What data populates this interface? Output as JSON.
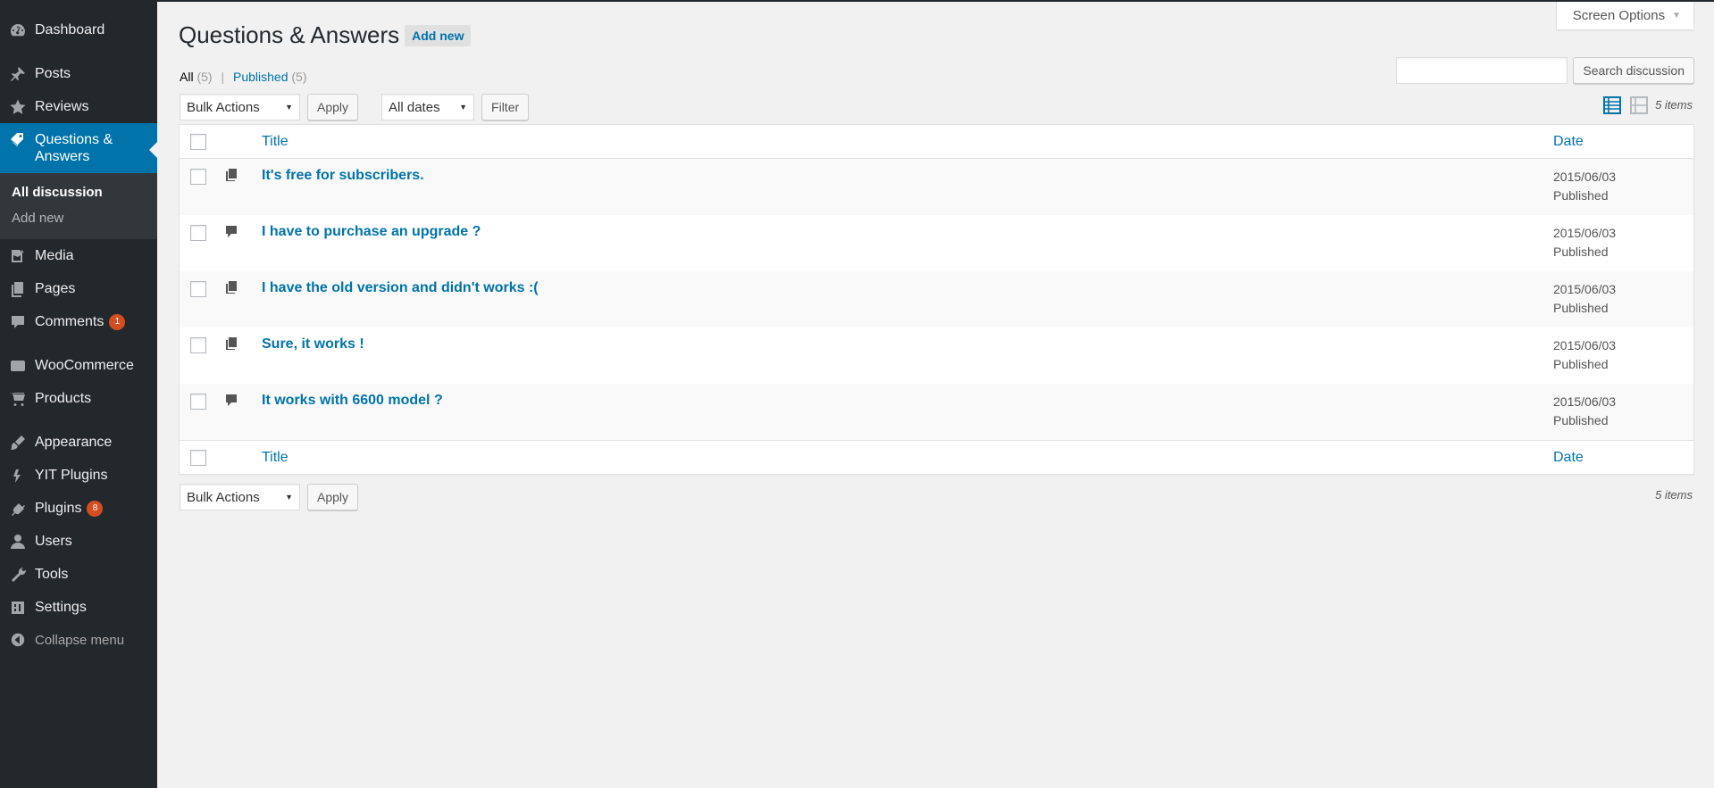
{
  "sidebar": {
    "items": [
      {
        "label": "Dashboard",
        "icon": "dashboard-icon"
      },
      {
        "label": "Posts",
        "icon": "pin-icon"
      },
      {
        "label": "Reviews",
        "icon": "star-icon"
      },
      {
        "label": "Questions & Answers",
        "icon": "tag-icon"
      },
      {
        "label": "Media",
        "icon": "media-icon"
      },
      {
        "label": "Pages",
        "icon": "pages-icon"
      },
      {
        "label": "Comments",
        "icon": "comment-icon",
        "badge": "1"
      },
      {
        "label": "WooCommerce",
        "icon": "woo-icon"
      },
      {
        "label": "Products",
        "icon": "cart-icon"
      },
      {
        "label": "Appearance",
        "icon": "brush-icon"
      },
      {
        "label": "YIT Plugins",
        "icon": "yit-icon"
      },
      {
        "label": "Plugins",
        "icon": "plug-icon",
        "badge": "8"
      },
      {
        "label": "Users",
        "icon": "user-icon"
      },
      {
        "label": "Tools",
        "icon": "wrench-icon"
      },
      {
        "label": "Settings",
        "icon": "settings-icon"
      }
    ],
    "submenu": [
      "All discussion",
      "Add new"
    ],
    "collapse": "Collapse menu"
  },
  "header": {
    "screen_options": "Screen Options",
    "title": "Questions & Answers",
    "add_new": "Add new"
  },
  "subsubsub": {
    "all": "All",
    "all_count": "(5)",
    "divider": "|",
    "published": "Published",
    "published_count": "(5)"
  },
  "search": {
    "placeholder": "",
    "button": "Search discussion"
  },
  "tablenav": {
    "bulk_actions": "Bulk Actions",
    "apply": "Apply",
    "all_dates": "All dates",
    "filter": "Filter",
    "items_count": "5 items"
  },
  "table": {
    "columns": {
      "title": "Title",
      "date": "Date"
    },
    "rows": [
      {
        "title": "It's free for subscribers.",
        "date": "2015/06/03",
        "status": "Published",
        "type_icon": "answer-icon"
      },
      {
        "title": "I have to purchase an upgrade ?",
        "date": "2015/06/03",
        "status": "Published",
        "type_icon": "question-icon"
      },
      {
        "title": "I have the old version and didn't works :(",
        "date": "2015/06/03",
        "status": "Published",
        "type_icon": "answer-icon"
      },
      {
        "title": "Sure, it works !",
        "date": "2015/06/03",
        "status": "Published",
        "type_icon": "answer-icon"
      },
      {
        "title": "It works with 6600 model ?",
        "date": "2015/06/03",
        "status": "Published",
        "type_icon": "question-icon"
      }
    ]
  },
  "colors": {
    "sidebar_bg": "#23282d",
    "accent": "#0073aa",
    "badge": "#d54e21"
  }
}
